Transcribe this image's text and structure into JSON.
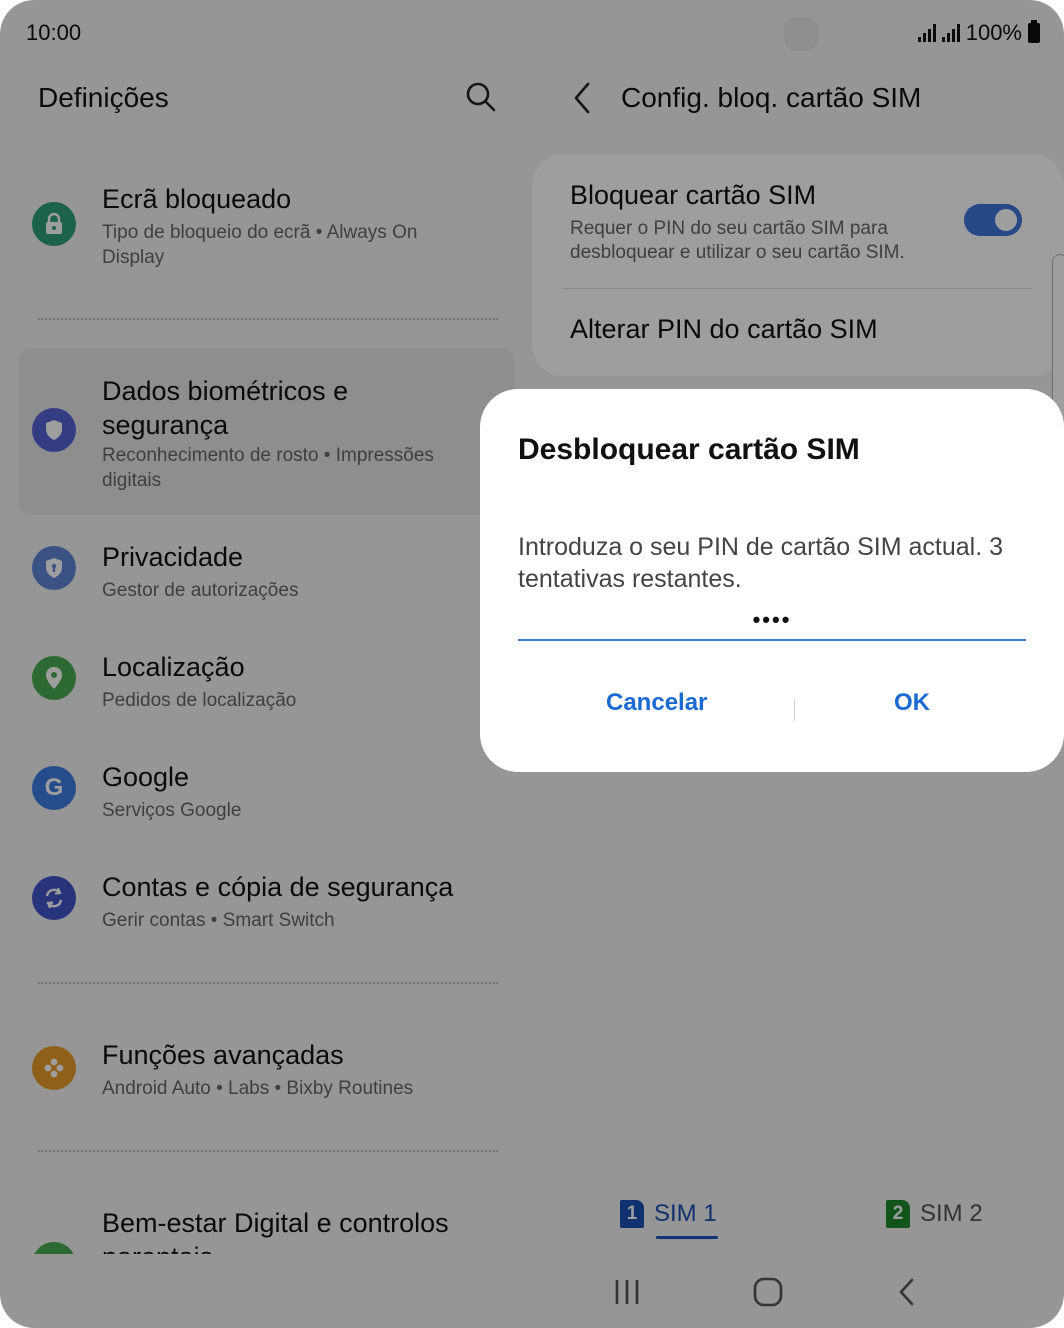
{
  "status": {
    "time": "10:00",
    "battery": "100%"
  },
  "left": {
    "title": "Definições",
    "items": [
      {
        "title": "Ecrã bloqueado",
        "subtitle": "Tipo de bloqueio do ecrã  •  Always On Display",
        "icon": "lock-icon",
        "color": "#2f9e7a"
      },
      {
        "title": "Dados biométricos e segurança",
        "subtitle": "Reconhecimento de rosto  •  Impressões digitais",
        "icon": "shield-icon",
        "color": "#5561d6"
      },
      {
        "title": "Privacidade",
        "subtitle": "Gestor de autorizações",
        "icon": "privacy-shield-icon",
        "color": "#5f86d6"
      },
      {
        "title": "Localização",
        "subtitle": "Pedidos de localização",
        "icon": "location-pin-icon",
        "color": "#4aaa52"
      },
      {
        "title": "Google",
        "subtitle": "Serviços Google",
        "icon": "google-icon",
        "color": "#3d7be0"
      },
      {
        "title": "Contas e cópia de segurança",
        "subtitle": "Gerir contas  •  Smart Switch",
        "icon": "sync-icon",
        "color": "#3f53c6"
      },
      {
        "title": "Funções avançadas",
        "subtitle": "Android Auto  •  Labs  •  Bixby Routines",
        "icon": "advanced-features-icon",
        "color": "#e59c2a"
      },
      {
        "title": "Bem-estar Digital e controlos parentais",
        "subtitle": "",
        "icon": "wellbeing-icon",
        "color": "#4aaa52"
      }
    ]
  },
  "right": {
    "title": "Config. bloq. cartão SIM",
    "lock_sim": {
      "title": "Bloquear cartão SIM",
      "subtitle": "Requer o PIN do seu cartão SIM para desbloquear e utilizar o seu cartão SIM.",
      "enabled": true
    },
    "change_pin": "Alterar PIN do cartão SIM",
    "sim_tabs": [
      {
        "num": "1",
        "label": "SIM 1",
        "color": "#1b4fb3"
      },
      {
        "num": "2",
        "label": "SIM 2",
        "color": "#1e8a2c"
      }
    ]
  },
  "dialog": {
    "title": "Desbloquear cartão SIM",
    "message": "Introduza o seu PIN de cartão SIM actual. 3 tentativas restantes.",
    "pin_value": "••••",
    "cancel": "Cancelar",
    "ok": "OK"
  }
}
